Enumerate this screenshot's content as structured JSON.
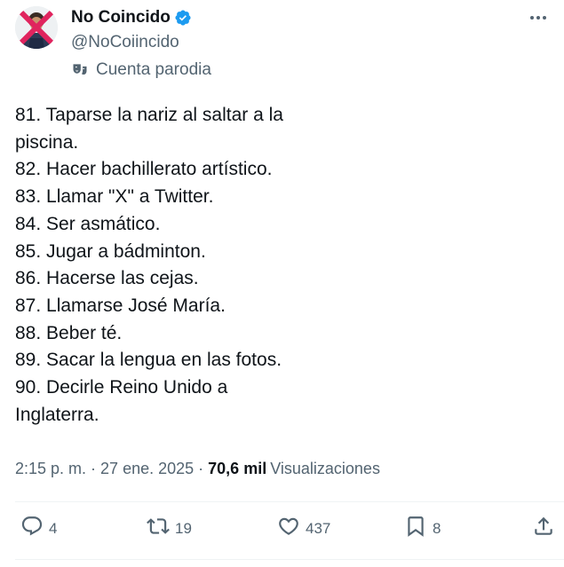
{
  "user": {
    "display_name": "No Coincido",
    "handle": "@NoCoiincido",
    "parody_label": "Cuenta parodia",
    "verified_color": "#1d9bf0"
  },
  "tweet": {
    "lines": [
      "81. Taparse la nariz al saltar a la",
      "piscina.",
      "82. Hacer bachillerato artístico.",
      "83. Llamar \"X\" a Twitter.",
      "84. Ser asmático.",
      "85. Jugar a bádminton.",
      "86. Hacerse las cejas.",
      "87. Llamarse José María.",
      "88. Beber té.",
      "89. Sacar la lengua en las fotos.",
      "90. Decirle Reino Unido a",
      "Inglaterra."
    ],
    "time": "2:15 p. m.",
    "date": "27 ene. 2025",
    "separator": "·",
    "views_count": "70,6 mil",
    "views_label": "Visualizaciones"
  },
  "actions": {
    "replies": "4",
    "reposts": "19",
    "likes": "437",
    "bookmarks": "8"
  },
  "icons": [
    "more-icon",
    "verified-badge-icon",
    "parody-mask-icon",
    "reply-icon",
    "repost-icon",
    "like-icon",
    "bookmark-icon",
    "share-icon"
  ]
}
